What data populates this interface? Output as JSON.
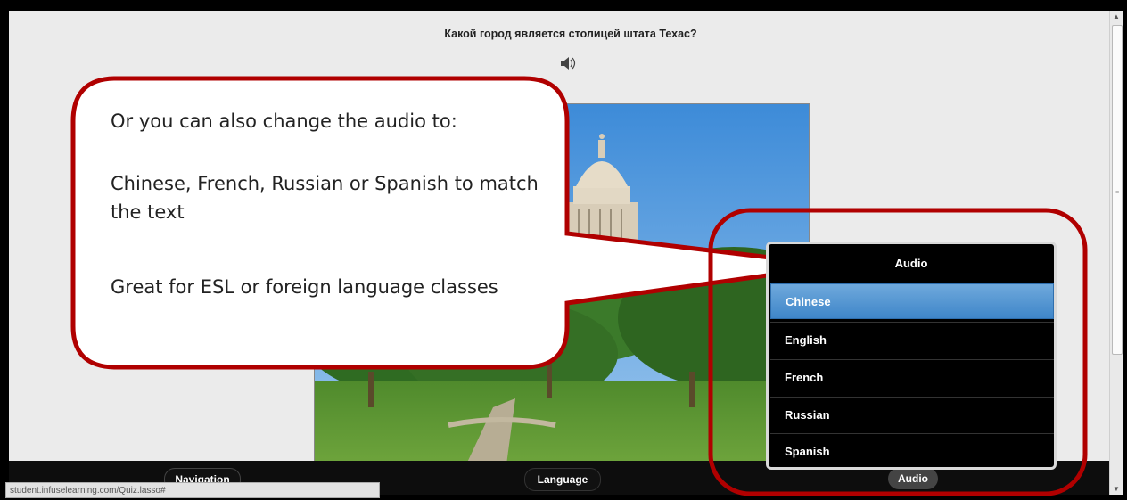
{
  "question": {
    "text": "Какой город является столицей штата Техас?"
  },
  "icons": {
    "speaker": "speaker-icon",
    "scroll_up": "scroll-up-arrow-icon",
    "scroll_down": "scroll-down-arrow-icon"
  },
  "callout": {
    "line1": "Or you can also change the audio to:",
    "line2": "Chinese, French, Russian or Spanish to match the text",
    "line3": "Great for ESL or foreign language classes"
  },
  "audio_menu": {
    "title": "Audio",
    "options": [
      "Chinese",
      "English",
      "French",
      "Russian",
      "Spanish"
    ],
    "selected": "Chinese"
  },
  "toolbar": {
    "navigation_label": "Navigation",
    "language_label": "Language",
    "audio_label": "Audio"
  },
  "status_bar": {
    "url": "student.infuselearning.com/Quiz.lasso#"
  },
  "colors": {
    "callout_border": "#b00000",
    "menu_selected": "#4a8fd0",
    "toolbar_bg": "#0d0d0d"
  }
}
